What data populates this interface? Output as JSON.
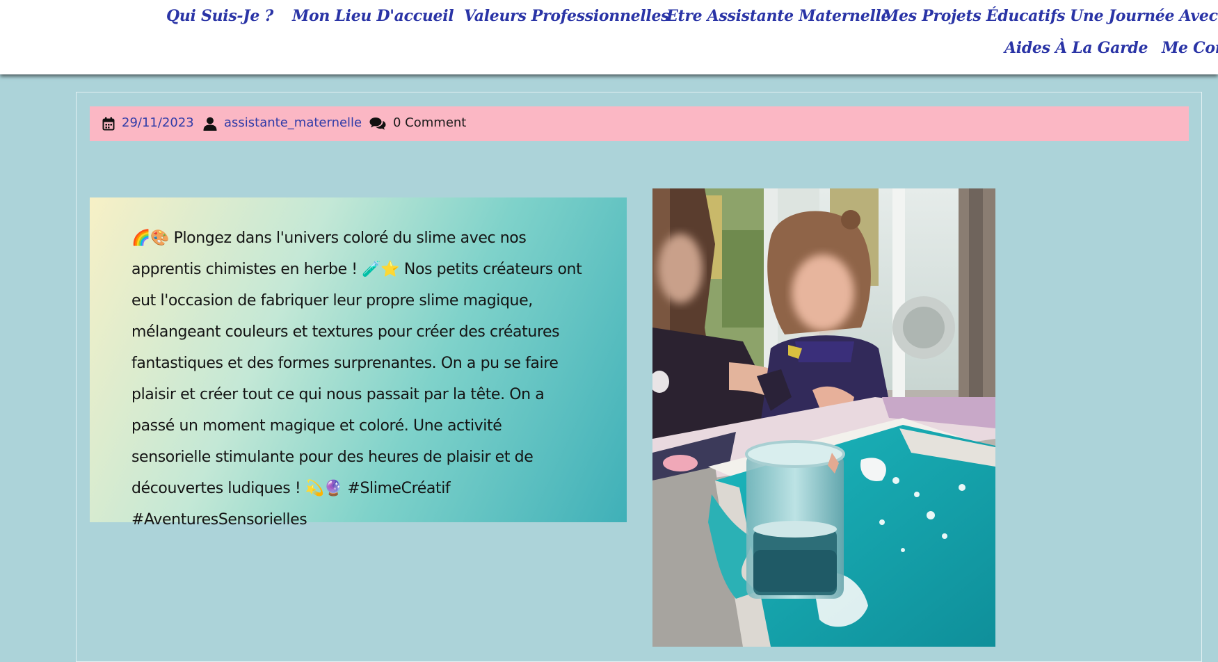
{
  "nav": {
    "row1": [
      "Qui Suis-Je ?",
      "Mon Lieu D'accueil",
      "Valeurs Professionnelles",
      "Etre Assistante Maternelle",
      "Mes Projets Éducatifs",
      "Une Journée Avec Cha"
    ],
    "row2": [
      "Aides À La Garde",
      "Me Cont"
    ]
  },
  "meta": {
    "date": "29/11/2023",
    "author": "assistante_maternelle",
    "comments": "0 Comment"
  },
  "post": {
    "text": "🌈🎨 Plongez dans l'univers coloré du slime avec nos apprentis chimistes en herbe ! 🧪⭐ Nos petits créateurs ont eut l'occasion de fabriquer leur propre slime magique, mélangeant couleurs et textures pour créer des créatures fantastiques et des formes surprenantes. On a pu se faire plaisir et créer tout ce qui nous passait par la tête. On a passé un moment magique et coloré. Une activité sensorielle stimulante pour des heures de plaisir et de découvertes ludiques ! 💫🔮 #SlimeCréatif #AventuresSensorielles"
  },
  "colors": {
    "background": "#acd3d9",
    "nav_link": "#2a34a6",
    "meta_bar": "#fbb7c4",
    "meta_link": "#2f3ba8"
  },
  "icons": [
    "calendar-icon",
    "user-icon",
    "comments-icon"
  ]
}
